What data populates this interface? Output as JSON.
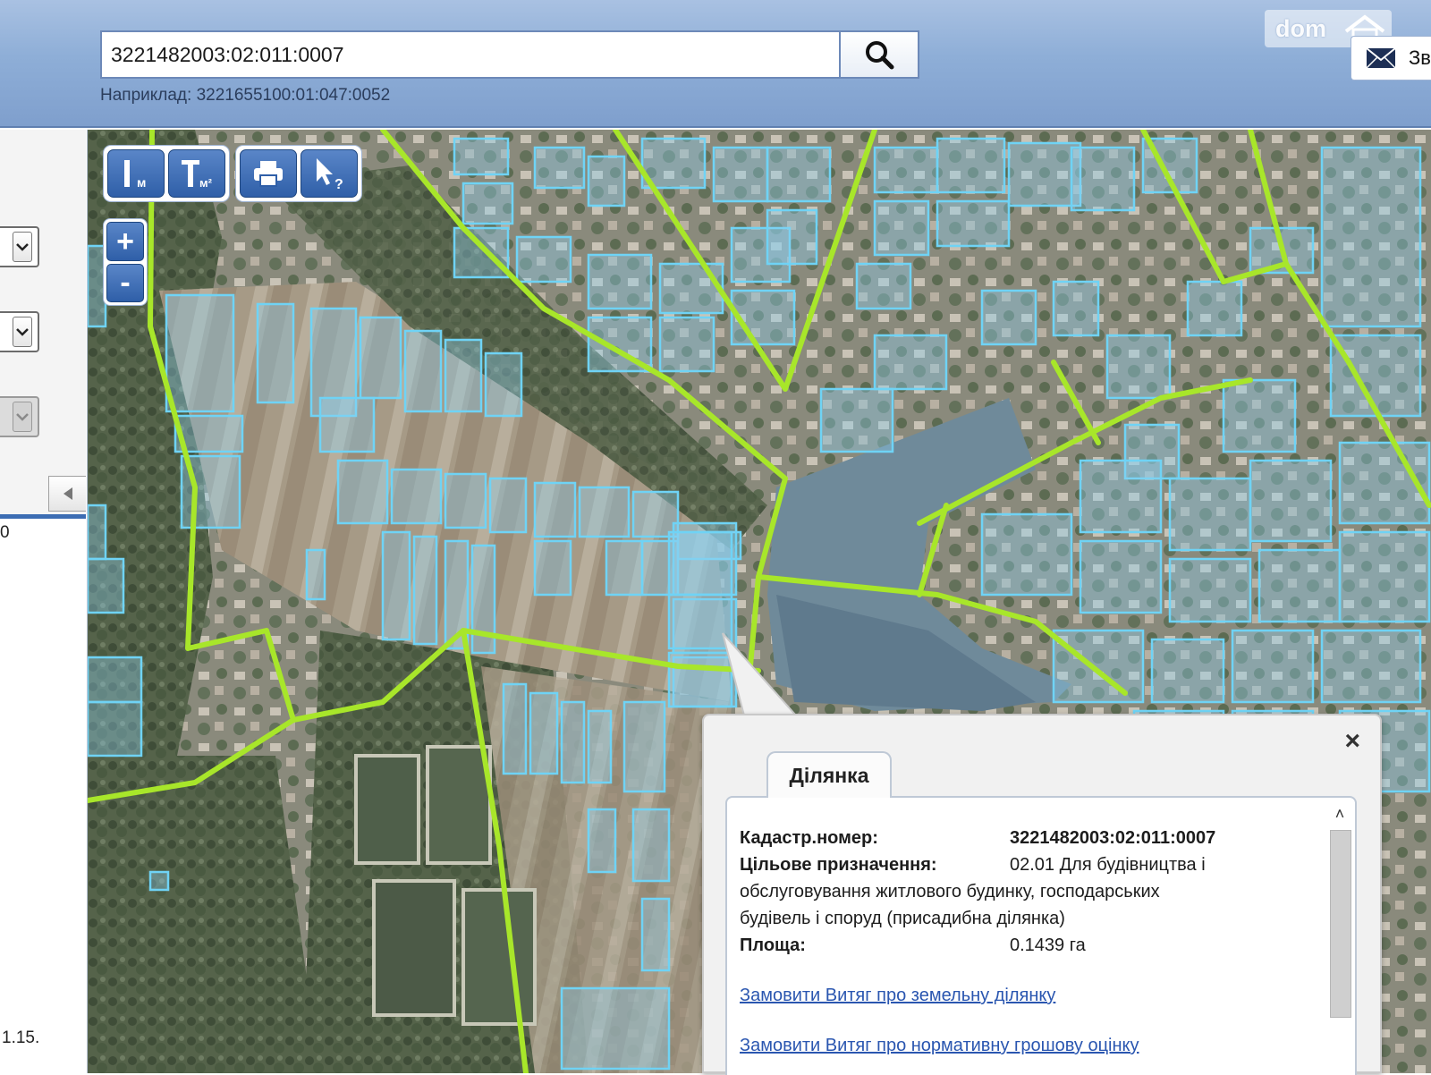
{
  "header": {
    "search_value": "3221482003:02:011:0007",
    "example_hint": "Наприклад: 3221655100:01:047:0052",
    "watermark": "dom",
    "feedback_label": "Зв"
  },
  "icons": {
    "search": "search-icon",
    "mail": "envelope-icon",
    "ruler": "measure-distance-icon",
    "area": "measure-area-icon",
    "print": "print-icon",
    "identify": "identify-cursor-icon"
  },
  "toolbar": {
    "measure_distance_sub": "м",
    "measure_area_sub": "м²",
    "identify_sub": "?"
  },
  "zoom": {
    "in_label": "+",
    "out_label": "-"
  },
  "left_panel": {
    "collapse_label": "◀",
    "scale_fragment": "0",
    "version_fragment": "1.15."
  },
  "popup": {
    "tab_label": "Ділянка",
    "close_label": "×",
    "scroll_up_label": "˄",
    "cadastral_label": "Кадастр.номер:",
    "cadastral_value": "3221482003:02:011:0007",
    "purpose_label": "Цільове призначення:",
    "purpose_value": "02.01 Для будівництва і",
    "purpose_value_cont": "обслуговування житлового будинку, господарських",
    "purpose_value_cont2": "будівель і споруд (присадибна ділянка)",
    "area_label": "Площа:",
    "area_value": "0.1439 га",
    "link_extract": "Замовити Витяг про земельну ділянку",
    "link_valuation": "Замовити Витяг про нормативну грошову оцінку"
  },
  "colors": {
    "header_bg": "#8eaed7",
    "button_blue": "#2f5fa8",
    "parcel_border": "#6fd3f5",
    "parcel_fill": "#8fd0f0",
    "boundary_line": "#a8e62a",
    "link": "#2a56b0"
  }
}
